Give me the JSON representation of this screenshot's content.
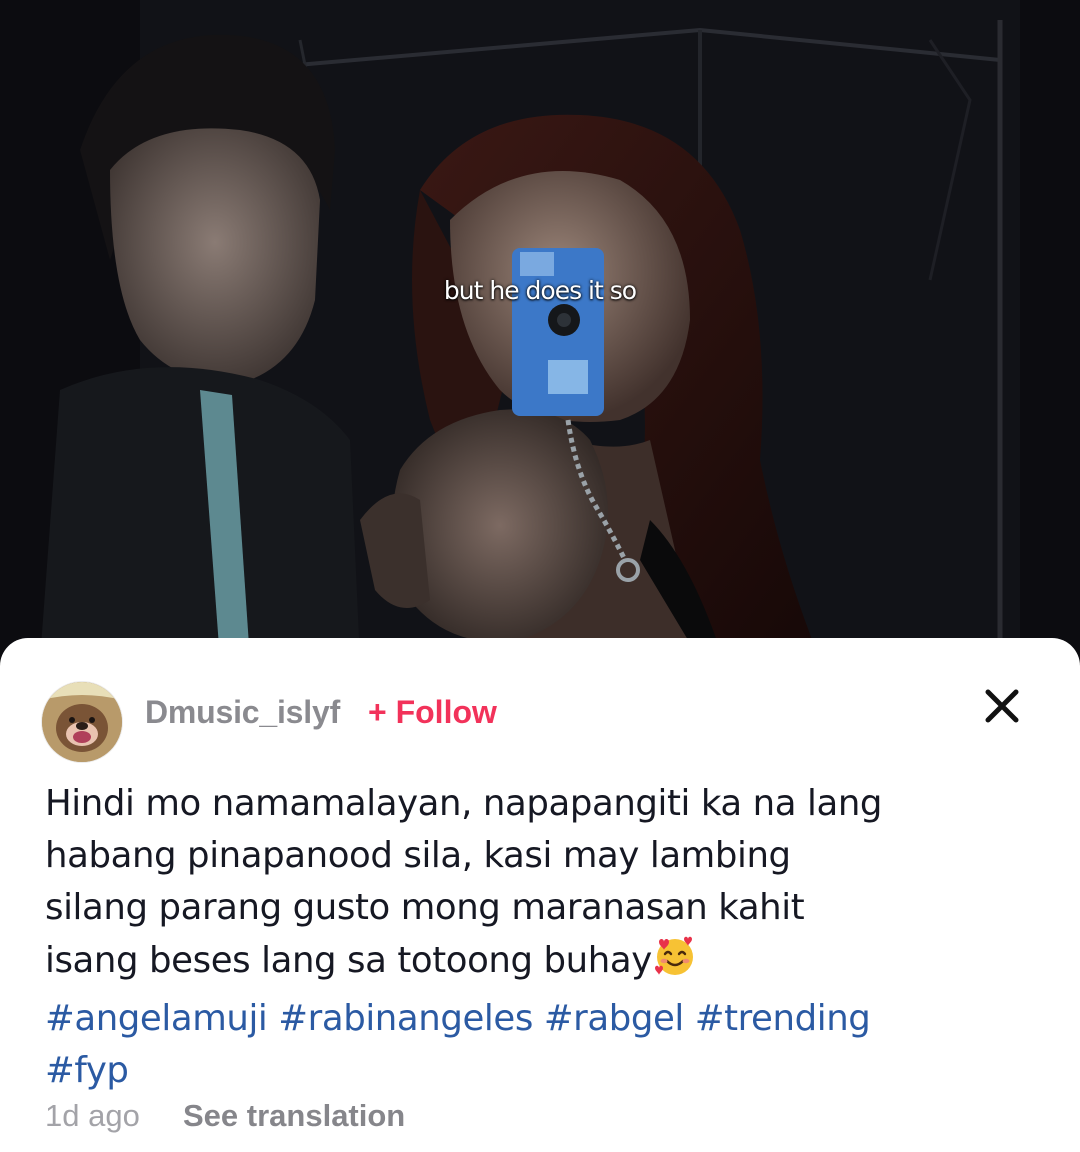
{
  "video": {
    "caption_overlay": "but he does it so"
  },
  "post": {
    "username": "Dmusic_islyf",
    "follow_label": "+ Follow",
    "description_lines": [
      "Hindi mo namamalayan, napapangiti ka na lang",
      "habang pinapanood sila, kasi may lambing",
      "silang parang gusto mong maranasan kahit",
      "isang beses lang sa totoong buhay"
    ],
    "emoji_name": "smiling-face-with-hearts-icon",
    "hashtags_line1": [
      "#angelamuji",
      "#rabinangeles",
      "#rabgel",
      "#trending"
    ],
    "hashtags_line2": [
      "#fyp"
    ],
    "time_ago": "1d ago",
    "translate_label": "See translation"
  },
  "icons": {
    "close": "close-icon",
    "avatar": "avatar"
  },
  "colors": {
    "follow": "#f2325a",
    "hashtag": "#2b5aa3",
    "username": "#8a8a8f",
    "sheet_bg": "#ffffff",
    "video_bg": "#0b0b0e"
  }
}
